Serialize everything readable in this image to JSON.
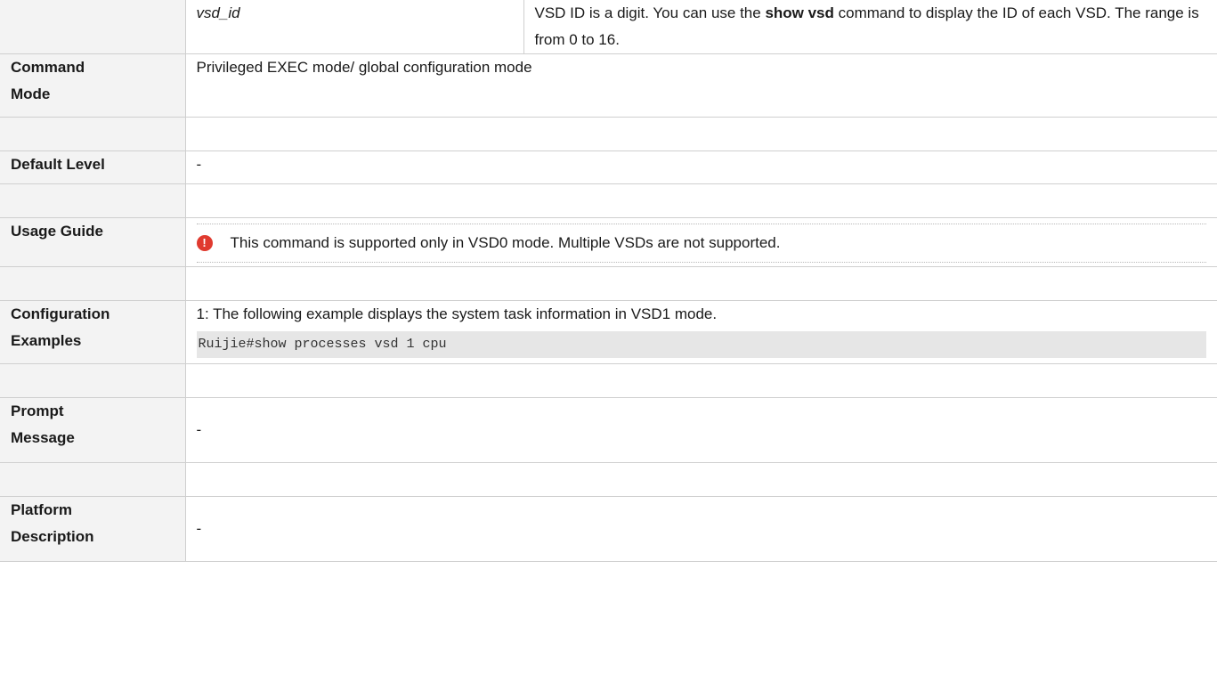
{
  "rows": {
    "param": {
      "name": "vsd_id",
      "desc_part1": "VSD ID is a digit. You can use the ",
      "desc_bold": "show vsd",
      "desc_part2": " command to display the ID of each VSD. The range is from 0 to 16."
    },
    "command_mode": {
      "label_line1": "Command",
      "label_line2": "Mode",
      "value": "Privileged EXEC mode/ global configuration mode"
    },
    "default_level": {
      "label": "Default Level",
      "value": "-"
    },
    "usage_guide": {
      "label": "Usage Guide",
      "icon": "warning-icon",
      "note": "This command is supported only in VSD0 mode. Multiple VSDs are not supported."
    },
    "config_examples": {
      "label_line1": "Configuration",
      "label_line2": "Examples",
      "description": "1: The following example displays the system task information in VSD1 mode.",
      "code": "Ruijie#show processes vsd 1 cpu"
    },
    "prompt_message": {
      "label_line1": "Prompt",
      "label_line2": "Message",
      "value": "-"
    },
    "platform_description": {
      "label_line1": "Platform",
      "label_line2": "Description",
      "value": "-"
    }
  },
  "colors": {
    "label_bg": "#f3f3f3",
    "code_bg": "#e6e6e6",
    "warning_icon": "#e03a2f",
    "border": "#cfcfcf"
  }
}
